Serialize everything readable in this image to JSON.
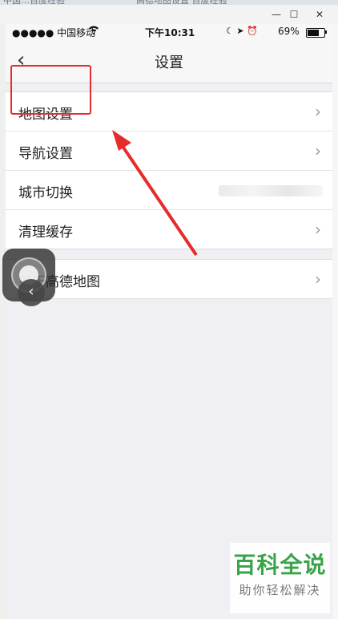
{
  "host": {
    "tab_left_text": "中国…百度经验",
    "tab_right_text": "高德地图设置 百度经验",
    "window_controls": [
      "—",
      "☐",
      "✕"
    ]
  },
  "status_bar": {
    "carrier": "●●●●● 中国移动",
    "time": "下午10:31",
    "battery_percent": "69%",
    "battery_level": 0.69
  },
  "nav": {
    "back_label": "‹",
    "title": "设置"
  },
  "settings": {
    "group1": [
      {
        "label": "地图设置",
        "chevron": "›"
      },
      {
        "label": "导航设置",
        "chevron": "›"
      },
      {
        "label": "城市切换",
        "chevron": ""
      },
      {
        "label": "清理缓存",
        "chevron": "›"
      }
    ],
    "group2": [
      {
        "label": "关于高德地图",
        "chevron": "›"
      }
    ]
  },
  "watermark": {
    "title": "百科全说",
    "subtitle": "助你轻松解决"
  },
  "colors": {
    "highlight": "#e52b2b",
    "watermark_green": "#3aa34a"
  },
  "icons": [
    "wifi-icon",
    "moon-icon",
    "location-icon",
    "alarm-icon",
    "battery-icon",
    "back-chevron-icon",
    "chevron-right-icon"
  ]
}
